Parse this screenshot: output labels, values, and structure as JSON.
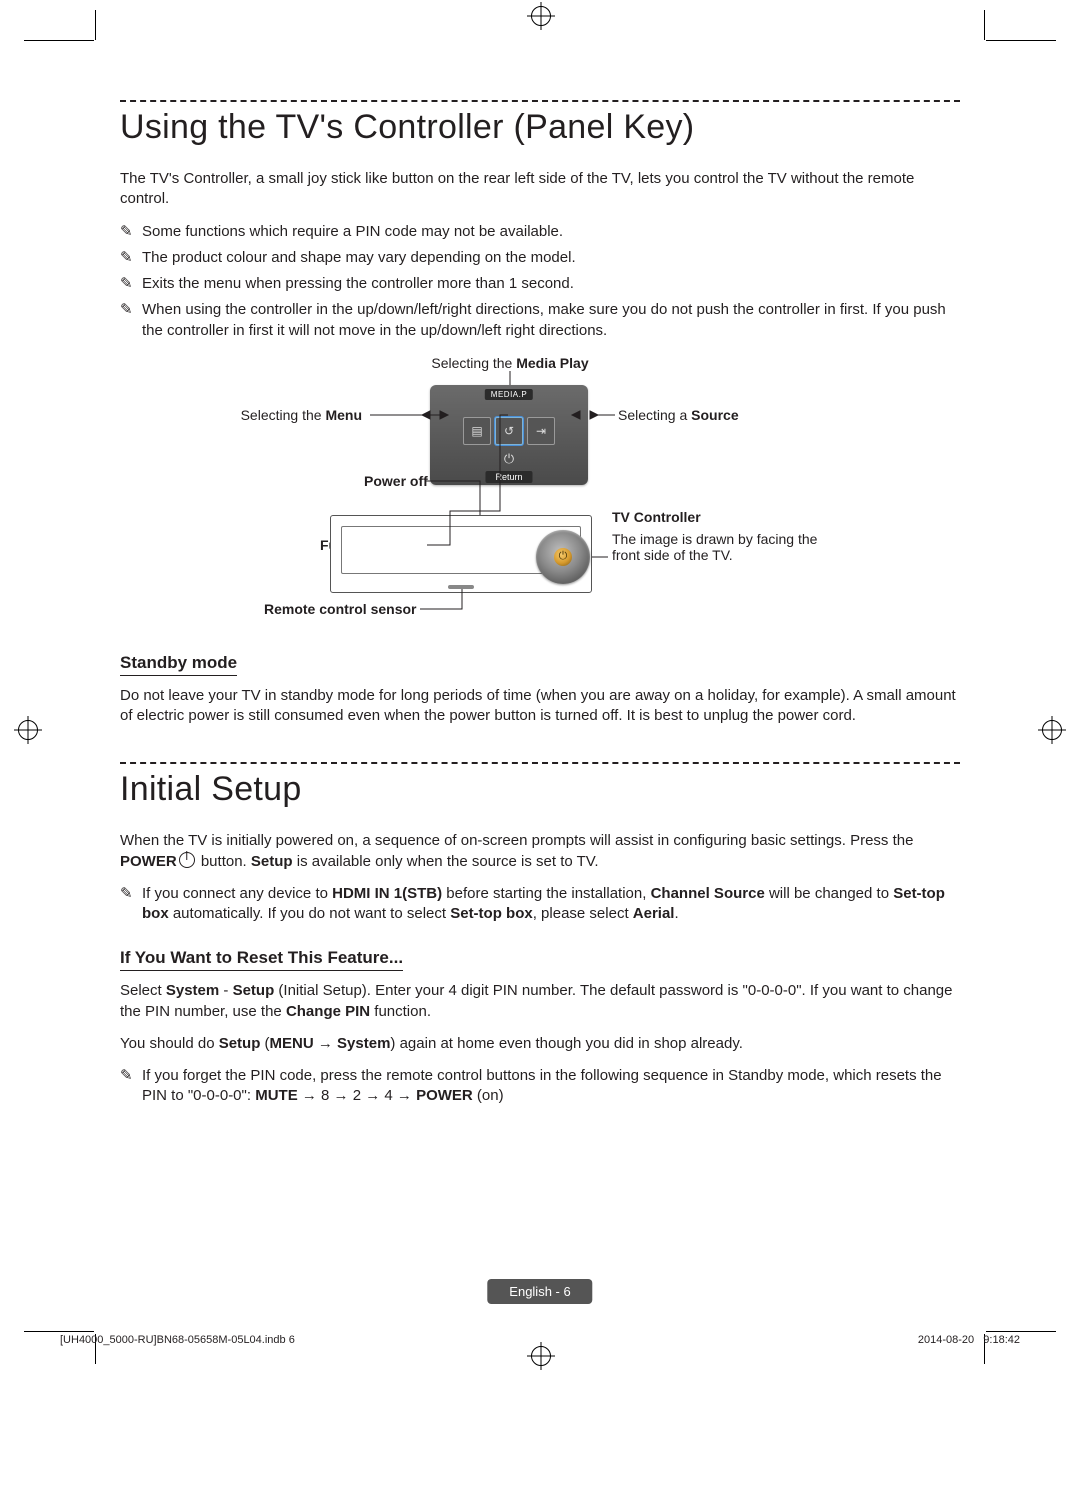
{
  "heading1": "Using the TV's Controller (Panel Key)",
  "intro1": "The TV's Controller, a small joy stick like button on the rear left side of the TV, lets you control the TV without the remote control.",
  "notes1": [
    "Some functions which require a PIN code may not be available.",
    "The product colour and shape may vary depending on the model.",
    "Exits the menu when pressing the controller more than 1 second.",
    "When using the controller in the up/down/left/right directions, make sure you do not push the controller in first. If you push the controller in first it will not move in the up/down/left right directions."
  ],
  "diagram": {
    "label_media_pre": "Selecting the ",
    "label_media_bold": "Media Play",
    "label_menu_pre": "Selecting the ",
    "label_menu_bold": "Menu",
    "label_source_pre": "Selecting a ",
    "label_source_bold": "Source",
    "label_poweroff": "Power off",
    "label_function_menu": "Function menu",
    "label_remote_sensor": "Remote control sensor",
    "label_tv_controller": "TV Controller",
    "tv_controller_note": "The image is drawn by facing the front side of the TV.",
    "osd_top": "MEDIA.P",
    "osd_return": "Return"
  },
  "standby_heading": "Standby mode",
  "standby_text": "Do not leave your TV in standby mode for long periods of time (when you are away on a holiday, for example). A small amount of electric power is still consumed even when the power button is turned off. It is best to unplug the power cord.",
  "heading2": "Initial Setup",
  "initial_pre": "When the TV is initially powered on, a sequence of on-screen prompts will assist in configuring basic settings. Press the ",
  "initial_power": "POWER",
  "initial_mid": " button. ",
  "initial_setup_bold": "Setup",
  "initial_post": " is available only when the source is set to TV.",
  "note_hdmi_parts": {
    "a": "If you connect any device to ",
    "b": "HDMI IN 1(STB)",
    "c": " before starting the installation, ",
    "d": "Channel Source",
    "e": " will be changed to ",
    "f": "Set-top box",
    "g": " automatically. If you do not want to select ",
    "h": "Set-top box",
    "i": ", please select ",
    "j": "Aerial",
    "k": "."
  },
  "reset_heading": "If You Want to Reset This Feature...",
  "reset_p1": {
    "a": "Select ",
    "b": "System",
    "c": " - ",
    "d": "Setup",
    "e": " (Initial Setup). Enter your 4 digit PIN number. The default password is \"0-0-0-0\". If you want to change the PIN number, use the ",
    "f": "Change PIN",
    "g": " function."
  },
  "reset_p2": {
    "a": "You should do ",
    "b": "Setup",
    "c": " (",
    "d": "MENU → System",
    "e": ") again at home even though you did in shop already."
  },
  "note_pin": {
    "a": "If you forget the PIN code, press the remote control buttons in the following sequence in Standby mode, which resets the PIN to \"0-0-0-0\": ",
    "b": "MUTE",
    "c": " → 8 → 2 → 4 → ",
    "d": "POWER",
    "e": " (on)"
  },
  "footer_lang": "English - 6",
  "footer_left": "[UH4000_5000-RU]BN68-05658M-05L04.indb   6",
  "footer_date": "2014-08-20",
  "footer_time": "9:18:42"
}
